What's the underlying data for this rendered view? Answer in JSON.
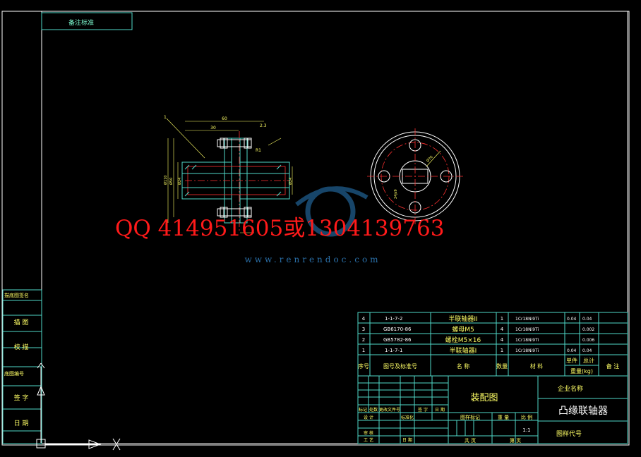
{
  "drawing": {
    "top_left_label": "备注标准",
    "company_label": "企业名称",
    "drawing_type": "装配图",
    "part_name": "凸缘联轴器",
    "drawing_number_label": "图样代号",
    "scale": "1:1"
  },
  "watermark": {
    "qq_text": "QQ 414951605或1304139763",
    "site": "www.renrendoc.com"
  },
  "side_panel": [
    "描底图签名",
    "描 图",
    "校 描",
    "底图编号",
    "签 字",
    "日 期"
  ],
  "bom": {
    "headers": {
      "seq": "序号",
      "code": "图号及标准号",
      "name": "名 称",
      "qty": "数量",
      "material": "材 料",
      "unit_weight": "单件",
      "total_weight": "总计",
      "weight": "重量(kg)",
      "note": "备 注"
    },
    "rows": [
      {
        "seq": "4",
        "code": "1-1-7-2",
        "name": "半联轴器II",
        "qty": "1",
        "material": "1Cr18Ni9Ti",
        "unit": "0.04",
        "total": "0.04"
      },
      {
        "seq": "3",
        "code": "GB6170-86",
        "name": "螺母M5",
        "qty": "4",
        "material": "1Cr18Ni9Ti",
        "unit": "",
        "total": "0.002"
      },
      {
        "seq": "2",
        "code": "GB5782-86",
        "name": "螺栓M5×16",
        "qty": "4",
        "material": "1Cr18Ni9Ti",
        "unit": "",
        "total": "0.006"
      },
      {
        "seq": "1",
        "code": "1-1-7-1",
        "name": "半联轴器I",
        "qty": "1",
        "material": "1Cr18Ni9Ti",
        "unit": "0.04",
        "total": "0.04"
      }
    ]
  },
  "title_block": {
    "rev_headers": [
      "标记",
      "处数",
      "更改文件号",
      "签 字",
      "日 期"
    ],
    "designer": "设 计",
    "standard": "标准化",
    "review": "审 核",
    "process": "工 艺",
    "date": "日 期",
    "stage": "图样标记",
    "weight": "重 量",
    "scale_label": "比 例",
    "sheets": "共  页",
    "sheet": "第  页"
  },
  "dims": {
    "d60": "60",
    "d30": "30",
    "d23": "2.3",
    "r1": "R1",
    "callout": "1",
    "phi110": "Ø110",
    "phi50": "Ø50",
    "phi24": "Ø24",
    "phi76": "Ø76",
    "phi24b": "Ø24",
    "phi24k": "24js9"
  }
}
